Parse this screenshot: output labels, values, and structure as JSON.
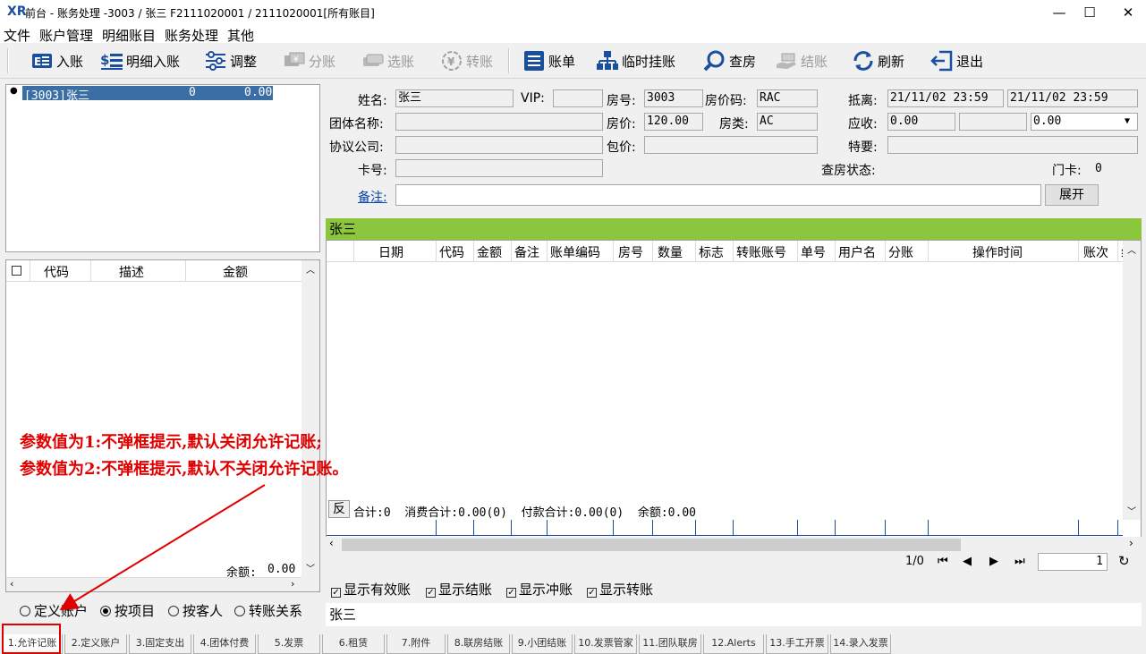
{
  "window": {
    "title": "前台 - 账务处理 -3003 / 张三 F2111020001 / 2111020001[所有账目]",
    "minimize": "—",
    "maximize": "☐",
    "close": "✕"
  },
  "menu": [
    "文件",
    "账户管理",
    "明细账目",
    "账务处理",
    "其他"
  ],
  "toolbar": {
    "entry": "入账",
    "detail_entry": "明细入账",
    "adjust": "调整",
    "split": "分账",
    "select": "选账",
    "transfer": "转账",
    "bill": "账单",
    "temp_hold": "临时挂账",
    "check_room": "查房",
    "settle": "结账",
    "refresh": "刷新",
    "exit": "退出"
  },
  "tree": {
    "node": "[3003]张三",
    "count": "0",
    "amount": "0.00"
  },
  "left_grid": {
    "headers": [
      "代码",
      "描述",
      "金额"
    ],
    "balance_label": "余额:",
    "balance_value": "0.00"
  },
  "guest": {
    "name_label": "姓名:",
    "name": "张三",
    "vip_label": "VIP:",
    "vip": "",
    "room_label": "房号:",
    "room": "3003",
    "rate_code_label": "房价码:",
    "rate_code": "RAC",
    "depart_label": "抵离:",
    "arrive_time": "21/11/02 23:59",
    "depart_time": "21/11/02 23:59",
    "group_label": "团体名称:",
    "group": "",
    "rate_label": "房价:",
    "rate": "120.00",
    "room_type_label": "房类:",
    "room_type": "AC",
    "receivable_label": "应收:",
    "receivable": "0.00",
    "receivable2": "",
    "receivable3": "0.00",
    "company_label": "协议公司:",
    "company": "",
    "package_label": "包价:",
    "package": "",
    "special_label": "特要:",
    "special": "",
    "card_label": "卡号:",
    "card": "",
    "check_status_label": "查房状态:",
    "door_card_label": "门卡:",
    "door_card": "0",
    "remark_label": "备注:",
    "remark": "",
    "expand_button": "展开"
  },
  "guest_bar": "张三",
  "main_grid": {
    "headers": [
      "日期",
      "代码",
      "金额",
      "备注",
      "账单编码",
      "房号",
      "数量",
      "标志",
      "转账账号",
      "单号",
      "用户名",
      "分账",
      "操作时间",
      "账次",
      "线"
    ]
  },
  "summary": {
    "reverse": "反",
    "text": "合计:0  消费合计:0.00(0)  付款合计:0.00(0)  余额:0.00"
  },
  "pager": {
    "page": "1/0",
    "first": "⏮",
    "prev": "◀",
    "next": "▶",
    "last": "⏭",
    "input": "1",
    "refresh": "↻"
  },
  "filters": [
    {
      "label": "显示有效账",
      "checked": true
    },
    {
      "label": "显示结账",
      "checked": true
    },
    {
      "label": "显示冲账",
      "checked": true
    },
    {
      "label": "显示转账",
      "checked": true
    }
  ],
  "bottom_name": "张三",
  "radios": [
    {
      "label": "定义账户",
      "checked": false
    },
    {
      "label": "按项目",
      "checked": true
    },
    {
      "label": "按客人",
      "checked": false
    },
    {
      "label": "转账关系",
      "checked": false
    }
  ],
  "annotation": {
    "line1": "参数值为1:不弹框提示,默认关闭允许记账;",
    "line2": "参数值为2:不弹框提示,默认不关闭允许记账。",
    "color": "#e00000"
  },
  "tabs": [
    "1.允许记账",
    "2.定义账户",
    "3.固定支出",
    "4.团体付费",
    "5.发票",
    "6.租赁",
    "7.附件",
    "8.联房结账",
    "9.小团结账",
    "10.发票管家",
    "11.团队联房",
    "12.Alerts",
    "13.手工开票",
    "14.录入发票"
  ],
  "colors": {
    "accent_green": "#8cc63f",
    "selection_blue": "#3a6ea5",
    "toolbar_icon": "#1a4fa0"
  }
}
